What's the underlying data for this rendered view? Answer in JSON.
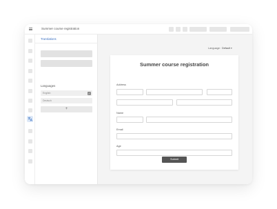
{
  "topbar": {
    "document_title": "Summer course registration"
  },
  "panel": {
    "tab_label": "Translations",
    "languages_heading": "Languages",
    "languages": [
      {
        "name": "English",
        "checked": true
      },
      {
        "name": "Deutsch",
        "checked": false
      }
    ],
    "add_label": "+"
  },
  "canvas": {
    "language_label": "Language:",
    "language_value": "Default",
    "language_caret": "▾"
  },
  "form": {
    "title": "Summer course registration",
    "address_label": "Address",
    "name_label": "Name",
    "email_label": "Email",
    "age_label": "Age",
    "submit_label": "Submit"
  },
  "colors": {
    "accent": "#3b6fc0",
    "submit": "#555555",
    "canvas": "#f4f4f4"
  }
}
